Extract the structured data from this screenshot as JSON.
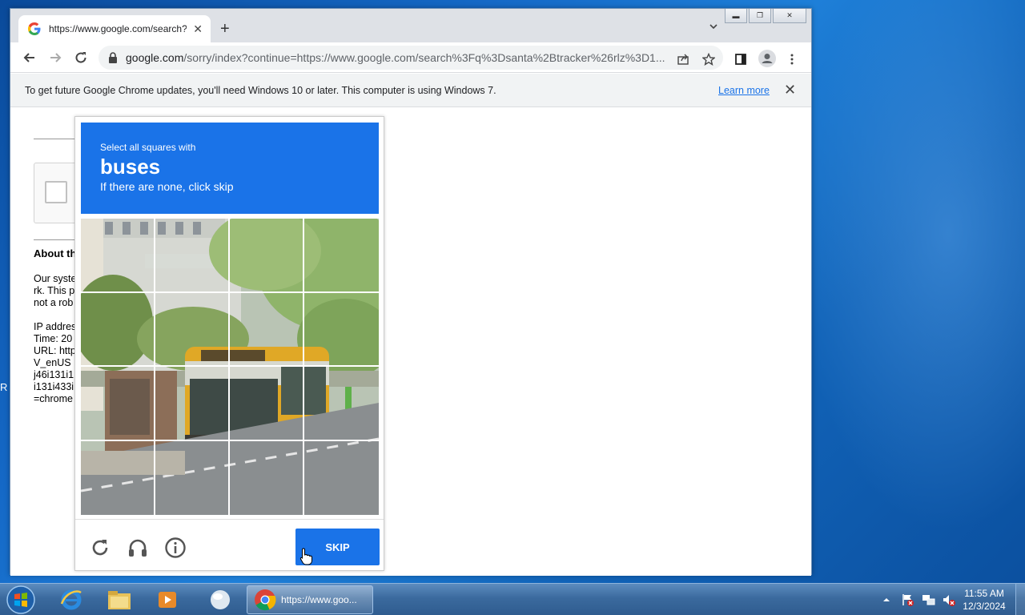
{
  "desktop": {
    "side_letters": [
      "R"
    ]
  },
  "browser": {
    "tab": {
      "title": "https://www.google.com/search?q",
      "favicon": "google-g-icon"
    },
    "omnibox": {
      "host": "google.com",
      "path": "/sorry/index?continue=https://www.google.com/search%3Fq%3Dsanta%2Btracker%26rlz%3D1..."
    },
    "infobar": {
      "message": "To get future Google Chrome updates, you'll need Windows 10 or later. This computer is using Windows 7.",
      "link": "Learn more"
    }
  },
  "page": {
    "about_heading": "About th",
    "text_lines": "Our syste\nrk. This p\nnot a rob\n\nIP addres\nTime: 20\nURL: http\nV_enUS\nj46i131i1\ni131i433i\n=chrome"
  },
  "captcha": {
    "instruction_small": "Select all squares with",
    "target": "buses",
    "instruction_hint": "If there are none, click skip",
    "skip_label": "SKIP",
    "accent": "#1a73e8",
    "grid_rows": 4,
    "grid_cols": 4
  },
  "taskbar": {
    "chrome_label": "https://www.goo...",
    "time": "11:55 AM",
    "date": "12/3/2024"
  }
}
